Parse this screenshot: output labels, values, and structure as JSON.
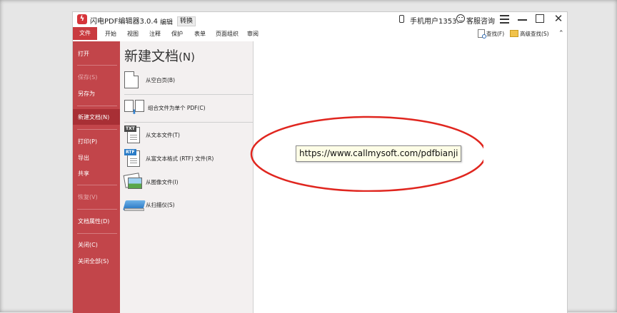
{
  "window": {
    "title": "闪电PDF编辑器3.0.4",
    "mode_edit": "编辑",
    "mode_convert": "转换",
    "user_label": "手机用户1353.",
    "service_label": "客服咨询",
    "icons": [
      "app-logo-icon",
      "phone-icon",
      "smile-icon",
      "menu-icon",
      "minimize-icon",
      "maximize-icon",
      "close-icon"
    ]
  },
  "ribbon": {
    "file_tab": "文件",
    "tabs": [
      "开始",
      "视图",
      "注释",
      "保护",
      "表单",
      "页面组织",
      "审阅"
    ],
    "find_label": "查找(F)",
    "advanced_find_label": "高级查找(S)",
    "collapse_glyph": "⌃"
  },
  "sidebar": {
    "items": [
      {
        "label": "打开",
        "enabled": true
      },
      {
        "label": "保存(S)",
        "enabled": false
      },
      {
        "label": "另存为",
        "enabled": true
      },
      {
        "label": "新建文档(N)",
        "enabled": true,
        "selected": true
      },
      {
        "label": "打印(P)",
        "enabled": true
      },
      {
        "label": "导出",
        "enabled": true
      },
      {
        "label": "共享",
        "enabled": true
      },
      {
        "label": "恢复(V)",
        "enabled": false
      },
      {
        "label": "文档属性(D)",
        "enabled": true
      },
      {
        "label": "关闭(C)",
        "enabled": true
      },
      {
        "label": "关闭全部(S)",
        "enabled": true
      }
    ]
  },
  "new_document": {
    "title": "新建文档",
    "title_shortcut": "(N)",
    "options": [
      {
        "label": "从空白页(B)",
        "icon": "blank-page-icon"
      },
      {
        "label": "组合文件为单个 PDF(C)",
        "icon": "combine-files-icon"
      },
      {
        "label": "从文本文件(T)",
        "icon": "txt-file-icon",
        "tag": "TXT"
      },
      {
        "label": "从富文本格式 (RTF) 文件(R)",
        "icon": "rtf-file-icon",
        "tag": "RTF"
      },
      {
        "label": "从图像文件(I)",
        "icon": "image-file-icon"
      },
      {
        "label": "从扫描仪(S)",
        "icon": "scanner-icon"
      }
    ]
  },
  "annotation": {
    "url": "https://www.callmysoft.com/pdfbianji",
    "ellipse_color": "#e0261f"
  },
  "colors": {
    "sidebar_bg": "#c2454a",
    "sidebar_selected": "#a82f35",
    "accent": "#c93a3f"
  }
}
